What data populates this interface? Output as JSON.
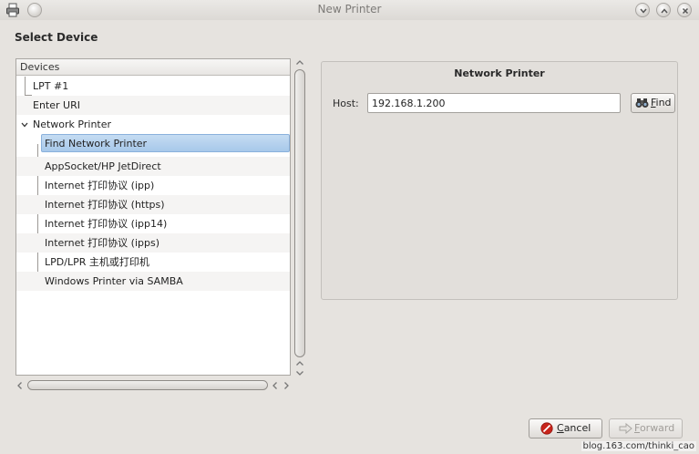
{
  "window": {
    "title": "New Printer"
  },
  "page": {
    "heading": "Select Device"
  },
  "tree": {
    "header": "Devices",
    "items": [
      {
        "label": "LPT #1"
      },
      {
        "label": "Enter URI"
      },
      {
        "label": "Network Printer"
      },
      {
        "label": "Find Network Printer"
      },
      {
        "label": "AppSocket/HP JetDirect"
      },
      {
        "label": "Internet 打印协议 (ipp)"
      },
      {
        "label": "Internet 打印协议 (https)"
      },
      {
        "label": "Internet 打印协议 (ipp14)"
      },
      {
        "label": "Internet 打印协议 (ipps)"
      },
      {
        "label": "LPD/LPR 主机或打印机"
      },
      {
        "label": "Windows Printer via SAMBA"
      }
    ]
  },
  "panel": {
    "title": "Network Printer",
    "host_label": "Host:",
    "host_value": "192.168.1.200",
    "find_mnemonic": "F",
    "find_rest": "ind"
  },
  "buttons": {
    "cancel_mnemonic": "C",
    "cancel_rest": "ancel",
    "forward_mnemonic": "F",
    "forward_rest": "orward"
  },
  "watermark": "blog.163.com/thinki_cao",
  "colors": {
    "background": "#e6e3df",
    "selection": "#a7c8ea",
    "cancel_icon": "#c8241b"
  },
  "icons": {
    "window_app": "printer-icon",
    "find": "binoculars-icon",
    "cancel": "cancel-icon",
    "forward": "forward-arrow-icon"
  }
}
